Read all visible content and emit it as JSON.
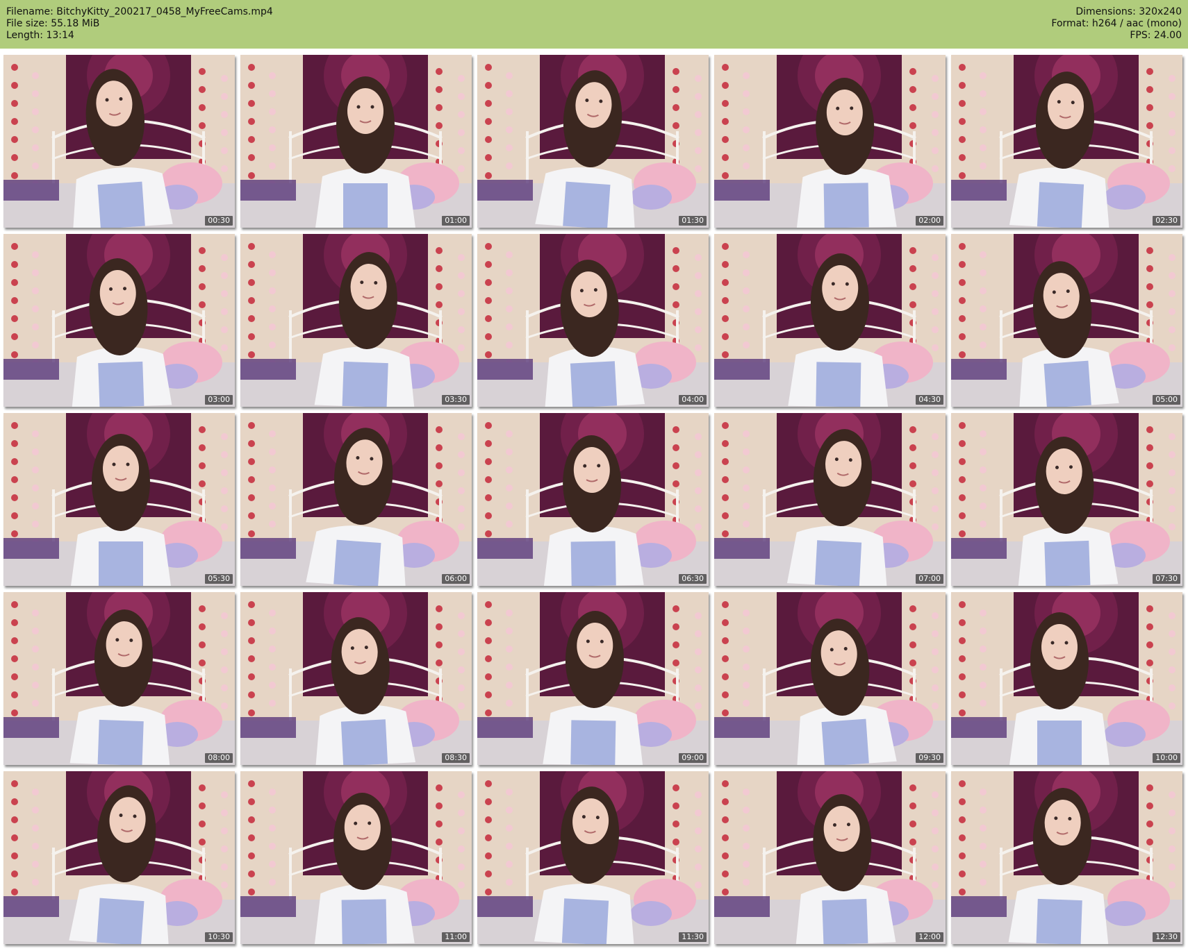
{
  "header": {
    "left": [
      "Filename: BitchyKitty_200217_0458_MyFreeCams.mp4",
      "File size: 55.18 MiB",
      "Length: 13:14"
    ],
    "right": [
      "Dimensions: 320x240",
      "Format: h264 / aac (mono)",
      "FPS: 24.00"
    ],
    "background_color": "#b0cc7c"
  },
  "thumbnails": [
    {
      "timestamp": "00:30"
    },
    {
      "timestamp": "01:00"
    },
    {
      "timestamp": "01:30"
    },
    {
      "timestamp": "02:00"
    },
    {
      "timestamp": "02:30"
    },
    {
      "timestamp": "03:00"
    },
    {
      "timestamp": "03:30"
    },
    {
      "timestamp": "04:00"
    },
    {
      "timestamp": "04:30"
    },
    {
      "timestamp": "05:00"
    },
    {
      "timestamp": "05:30"
    },
    {
      "timestamp": "06:00"
    },
    {
      "timestamp": "06:30"
    },
    {
      "timestamp": "07:00"
    },
    {
      "timestamp": "07:30"
    },
    {
      "timestamp": "08:00"
    },
    {
      "timestamp": "08:30"
    },
    {
      "timestamp": "09:00"
    },
    {
      "timestamp": "09:30"
    },
    {
      "timestamp": "10:00"
    },
    {
      "timestamp": "10:30"
    },
    {
      "timestamp": "11:00"
    },
    {
      "timestamp": "11:30"
    },
    {
      "timestamp": "12:00"
    },
    {
      "timestamp": "12:30"
    }
  ],
  "colors": {
    "tapestry": "#5a1a3d",
    "wall": "#e6d5c5",
    "heart": "#c4283a",
    "shirt": "#f4f4f6",
    "hair": "#3b2720",
    "bedding": "#d8d2d6",
    "plush_pink": "#f0b4c8"
  }
}
